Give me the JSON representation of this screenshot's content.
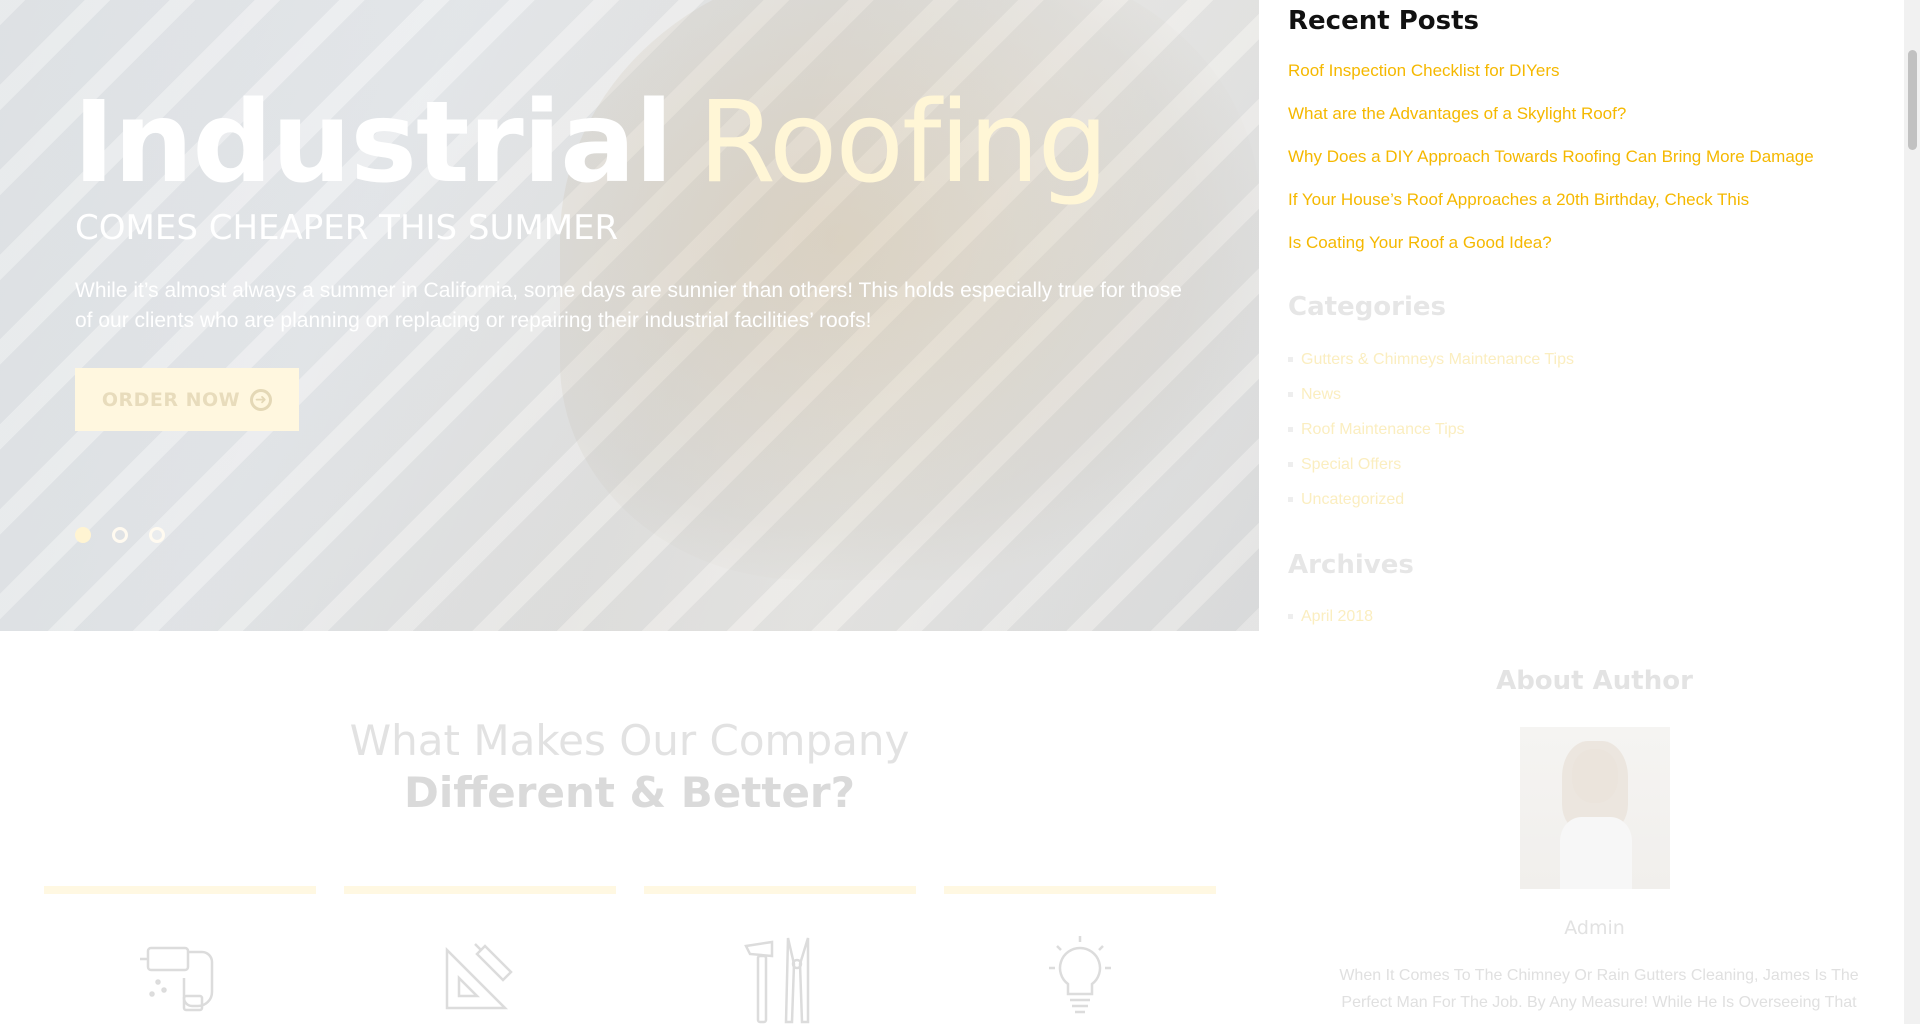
{
  "hero": {
    "title_strong": "Industrial",
    "title_light": "Roofing",
    "subtitle": "COMES CHEAPER THIS SUMMER",
    "text": "While it’s almost always a summer in California, some days are sunnier than others! This holds especially true for those of our clients who are planning on replacing or repairing their industrial facilities’ roofs!",
    "button_label": "ORDER NOW",
    "button_icon": "circle-arrow-right-icon",
    "slides_count": 3,
    "active_slide": 1
  },
  "company": {
    "heading_line1": "What Makes Our Company",
    "heading_line2": "Different & Better?",
    "features": [
      {
        "icon": "drill-icon"
      },
      {
        "icon": "ruler-pencil-icon"
      },
      {
        "icon": "hammer-pliers-icon"
      },
      {
        "icon": "lightbulb-icon"
      }
    ]
  },
  "sidebar": {
    "recent_posts": {
      "title": "Recent Posts",
      "items": [
        "Roof Inspection Checklist for DIYers",
        "What are the Advantages of a Skylight Roof?",
        "Why Does a DIY Approach Towards Roofing Can Bring More Damage",
        "If Your House’s Roof Approaches a 20th Birthday, Check This",
        "Is Coating Your Roof a Good Idea?"
      ]
    },
    "categories": {
      "title": "Categories",
      "items": [
        "Gutters & Chimneys Maintenance Tips",
        "News",
        "Roof Maintenance Tips",
        "Special Offers",
        "Uncategorized"
      ]
    },
    "archives": {
      "title": "Archives",
      "items": [
        "April 2018"
      ]
    },
    "about": {
      "title": "About Author",
      "name": "Admin",
      "bio": "When It Comes To The Chimney Or Rain Gutters Cleaning, James Is The Perfect Man For The Job. By Any Measure! While He Is Overseeing That"
    }
  },
  "colors": {
    "accent": "#f5b800",
    "hero_overlay": "#f3f4f5",
    "button_bg": "#fff7df"
  }
}
